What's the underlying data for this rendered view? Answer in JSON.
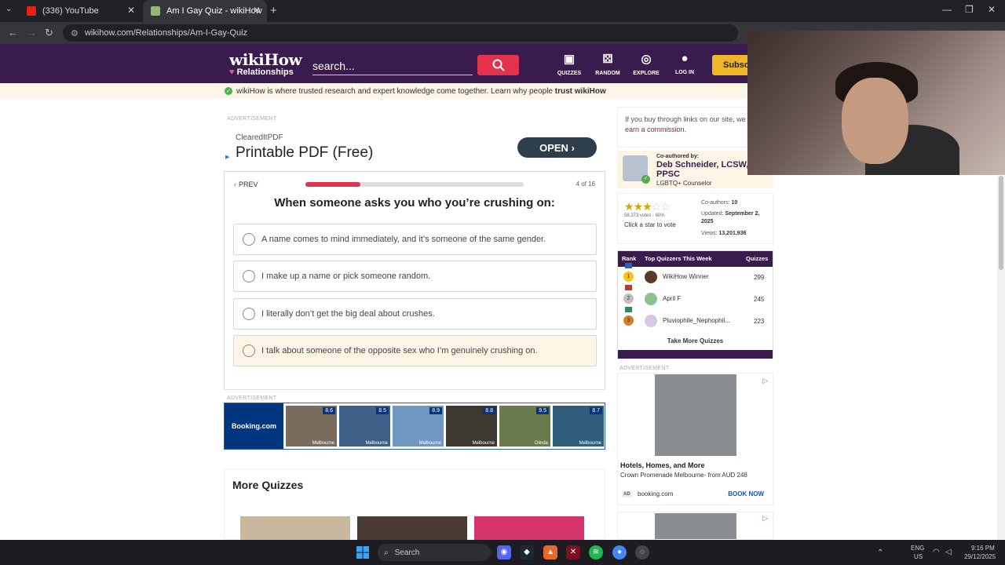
{
  "browser": {
    "tabs": [
      {
        "title": "(336) YouTube"
      },
      {
        "title": "Am I Gay Quiz - wikiHow"
      }
    ],
    "url": "wikihow.com/Relationships/Am-I-Gay-Quiz"
  },
  "header": {
    "logo_main": "wikiHow",
    "logo_sub": "Relationships",
    "search_placeholder": "search...",
    "nav": [
      {
        "label": "QUIZZES",
        "icon": "quizzes-icon"
      },
      {
        "label": "RANDOM",
        "icon": "dice-icon"
      },
      {
        "label": "EXPLORE",
        "icon": "compass-icon"
      },
      {
        "label": "LOG IN",
        "icon": "user-icon"
      }
    ],
    "subscribe_label": "Subscri"
  },
  "trust_bar": {
    "text": "wikiHow is where trusted research and expert knowledge come together. Learn why people",
    "bold": "trust wikiHow"
  },
  "ad_top": {
    "label": "ADVERTISEMENT",
    "brand": "ClearedItPDF",
    "headline": "Printable PDF (Free)",
    "cta": "OPEN"
  },
  "quiz": {
    "prev_label": "PREV",
    "progress": 0.25,
    "counter": "4 of 16",
    "question": "When someone asks you who you’re crushing on:",
    "options": [
      "A name comes to mind immediately, and it’s someone of the same gender.",
      "I make up a name or pick someone random.",
      "I literally don’t get the big deal about crushes.",
      "I talk about someone of the opposite sex who I’m genuinely crushing on."
    ]
  },
  "ad_booking": {
    "label": "ADVERTISEMENT",
    "brand": "Booking.com",
    "hotels": [
      {
        "score": "8.6",
        "city": "Melbourne",
        "color": "#7a6b5f"
      },
      {
        "score": "8.5",
        "city": "Melbourne",
        "color": "#3d5f88"
      },
      {
        "score": "8.9",
        "city": "Melbourne",
        "color": "#6f97c2"
      },
      {
        "score": "8.8",
        "city": "Melbourne",
        "color": "#3c3830"
      },
      {
        "score": "9.5",
        "city": "Olinda",
        "color": "#6a7a4a"
      },
      {
        "score": "8.7",
        "city": "Melbourne",
        "color": "#2f5d7c"
      }
    ]
  },
  "more_quizzes": {
    "title": "More Quizzes",
    "thumbs": [
      "#c9b89e",
      "#4a3b32",
      "#d6336c"
    ]
  },
  "sidebar": {
    "disclosure_text": "If you buy through links on our site, we",
    "disclosure_link": "earn a commission",
    "coauthor": {
      "heading": "Co-authored by:",
      "name": "Deb Schneider, LCSW, PPSC",
      "title": "LGBTQ+ Counselor"
    },
    "rating": {
      "filled_stars": 3,
      "total_stars": 5,
      "votes": "58,373 votes - 60%",
      "cta": "Click a star to vote"
    },
    "stats": {
      "coauthors_label": "Co-authors:",
      "coauthors": "10",
      "updated_label": "Updated:",
      "updated": "September 2, 2025",
      "views_label": "Views:",
      "views": "13,201,936"
    },
    "leaderboard": {
      "col_rank": "Rank",
      "col_name": "Top Quizzers This Week",
      "col_count": "Quizzes",
      "rows": [
        {
          "rank": "1",
          "name": "WikiHow Winner",
          "count": "299",
          "medal": "#f5c518",
          "avatar": "#5b3a2a"
        },
        {
          "rank": "2",
          "name": "April F",
          "count": "245",
          "medal": "#c0c0c0",
          "avatar": "#8fbf8f"
        },
        {
          "rank": "3",
          "name": "Pluviophile_Nephophil...",
          "count": "223",
          "medal": "#cd7f32",
          "avatar": "#d8c8e8"
        }
      ],
      "take_more": "Take More Quizzes"
    },
    "ad_hotel": {
      "label": "ADVERTISEMENT",
      "title": "Hotels, Homes, and More",
      "subtitle": "Crown Promenade Melbourne- from AUD 248",
      "ad_badge": "AD",
      "domain": "booking.com",
      "cta": "BOOK NOW"
    }
  },
  "taskbar": {
    "search_label": "Search",
    "lang_top": "ENG",
    "lang_bottom": "US",
    "time": "9:16 PM",
    "date": "29/12/2025"
  }
}
